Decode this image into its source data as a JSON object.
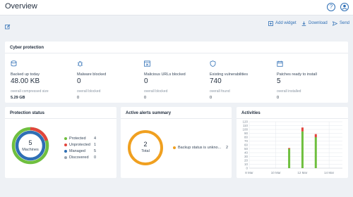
{
  "header": {
    "title": "Overview",
    "help_icon": "question-circle-icon",
    "account_icon": "user-circle-icon"
  },
  "toolbar": {
    "add_widget": "Add widget",
    "download": "Download",
    "send": "Send",
    "left_icon": "edit-icon"
  },
  "cyber": {
    "title": "Cyber protection",
    "metrics": [
      {
        "label": "Backed up today",
        "value": "48.00 KB",
        "sub_label": "overall compressed size",
        "sub_value": "5.29 GB",
        "icon": "database-icon"
      },
      {
        "label": "Malware blocked",
        "value": "0",
        "sub_label": "overall blocked",
        "sub_value": "0",
        "icon": "bug-icon"
      },
      {
        "label": "Malicious URLs blocked",
        "value": "0",
        "sub_label": "overall blocked",
        "sub_value": "0",
        "icon": "browser-icon"
      },
      {
        "label": "Existing vulnerabilities",
        "value": "740",
        "sub_label": "overall found",
        "sub_value": "0",
        "icon": "shield-icon"
      },
      {
        "label": "Patches ready to install",
        "value": "5",
        "sub_label": "overall installed",
        "sub_value": "0",
        "icon": "calendar-icon"
      }
    ]
  },
  "protection": {
    "title": "Protection status",
    "center_value": "5",
    "center_label": "Machines",
    "legend": [
      {
        "label": "Protected",
        "count": "4",
        "color": "#6fbf3f"
      },
      {
        "label": "Unprotected",
        "count": "1",
        "color": "#e2453c"
      },
      {
        "label": "Managed",
        "count": "5",
        "color": "#2f6fb5"
      },
      {
        "label": "Discovered",
        "count": "0",
        "color": "#9aa4ae"
      }
    ]
  },
  "alerts": {
    "title": "Active alerts summary",
    "center_value": "2",
    "center_label": "Total",
    "items": [
      {
        "label": "Backup status is unkno...",
        "count": "2",
        "color": "#f0a020"
      }
    ]
  },
  "chart_data": {
    "type": "bar",
    "title": "Activities",
    "ylim": [
      0,
      120
    ],
    "yticks": [
      "120",
      "110",
      "100",
      "90",
      "80",
      "70",
      "60",
      "50",
      "40",
      "30",
      "20",
      "10",
      "0"
    ],
    "xticks": [
      "8 Mar",
      "10 Mar",
      "12 Mar",
      "14 Mar"
    ],
    "x": [
      "11 Mar",
      "12 Mar",
      "13 Mar"
    ],
    "series": [
      {
        "color": "#6fbf3f",
        "values": [
          50,
          95,
          80
        ]
      },
      {
        "color": "#e2453c",
        "values": [
          2,
          10,
          8
        ]
      }
    ],
    "grid": true
  }
}
